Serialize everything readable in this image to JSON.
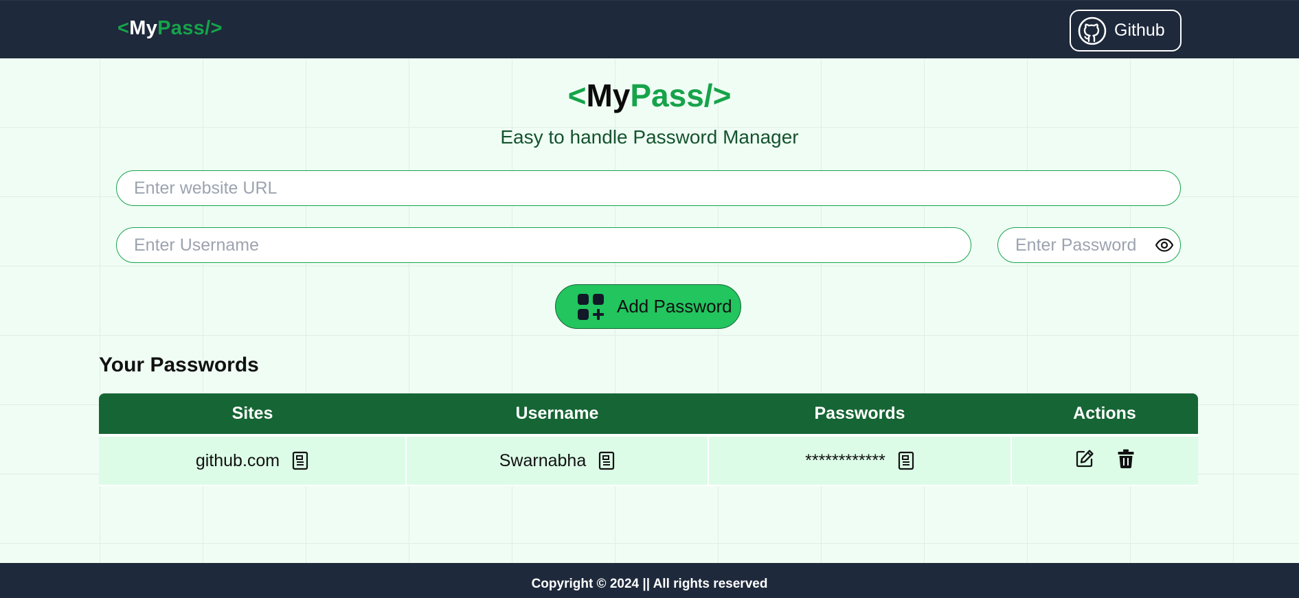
{
  "navbar": {
    "logo": {
      "open": "<",
      "first": "My",
      "second": "Pass/",
      "close": ">"
    },
    "github_label": "Github"
  },
  "hero": {
    "logo": {
      "open": "<",
      "first": "My",
      "second": "Pass/",
      "close": ">"
    },
    "subtitle": "Easy to handle Password Manager"
  },
  "form": {
    "url_placeholder": "Enter website URL",
    "url_value": "",
    "username_placeholder": "Enter Username",
    "username_value": "",
    "password_placeholder": "Enter Password",
    "password_value": "",
    "add_label": "Add Password"
  },
  "passwords": {
    "heading": "Your Passwords",
    "columns": [
      "Sites",
      "Username",
      "Passwords",
      "Actions"
    ],
    "rows": [
      {
        "site": "github.com",
        "username": "Swarnabha",
        "password": "************"
      }
    ]
  },
  "footer": {
    "text": "Copyright © 2024 || All rights reserved"
  },
  "colors": {
    "navbar_bg": "#1e293b",
    "brand_green": "#16a34a",
    "button_green": "#22c55e",
    "table_header": "#166534",
    "table_row": "#dcfce7",
    "page_bg": "#effdf4"
  },
  "icons": {
    "github": "github-icon",
    "eye": "eye-icon",
    "add": "add-grid-icon",
    "copy": "copy-icon",
    "edit": "edit-icon",
    "delete": "trash-icon"
  }
}
